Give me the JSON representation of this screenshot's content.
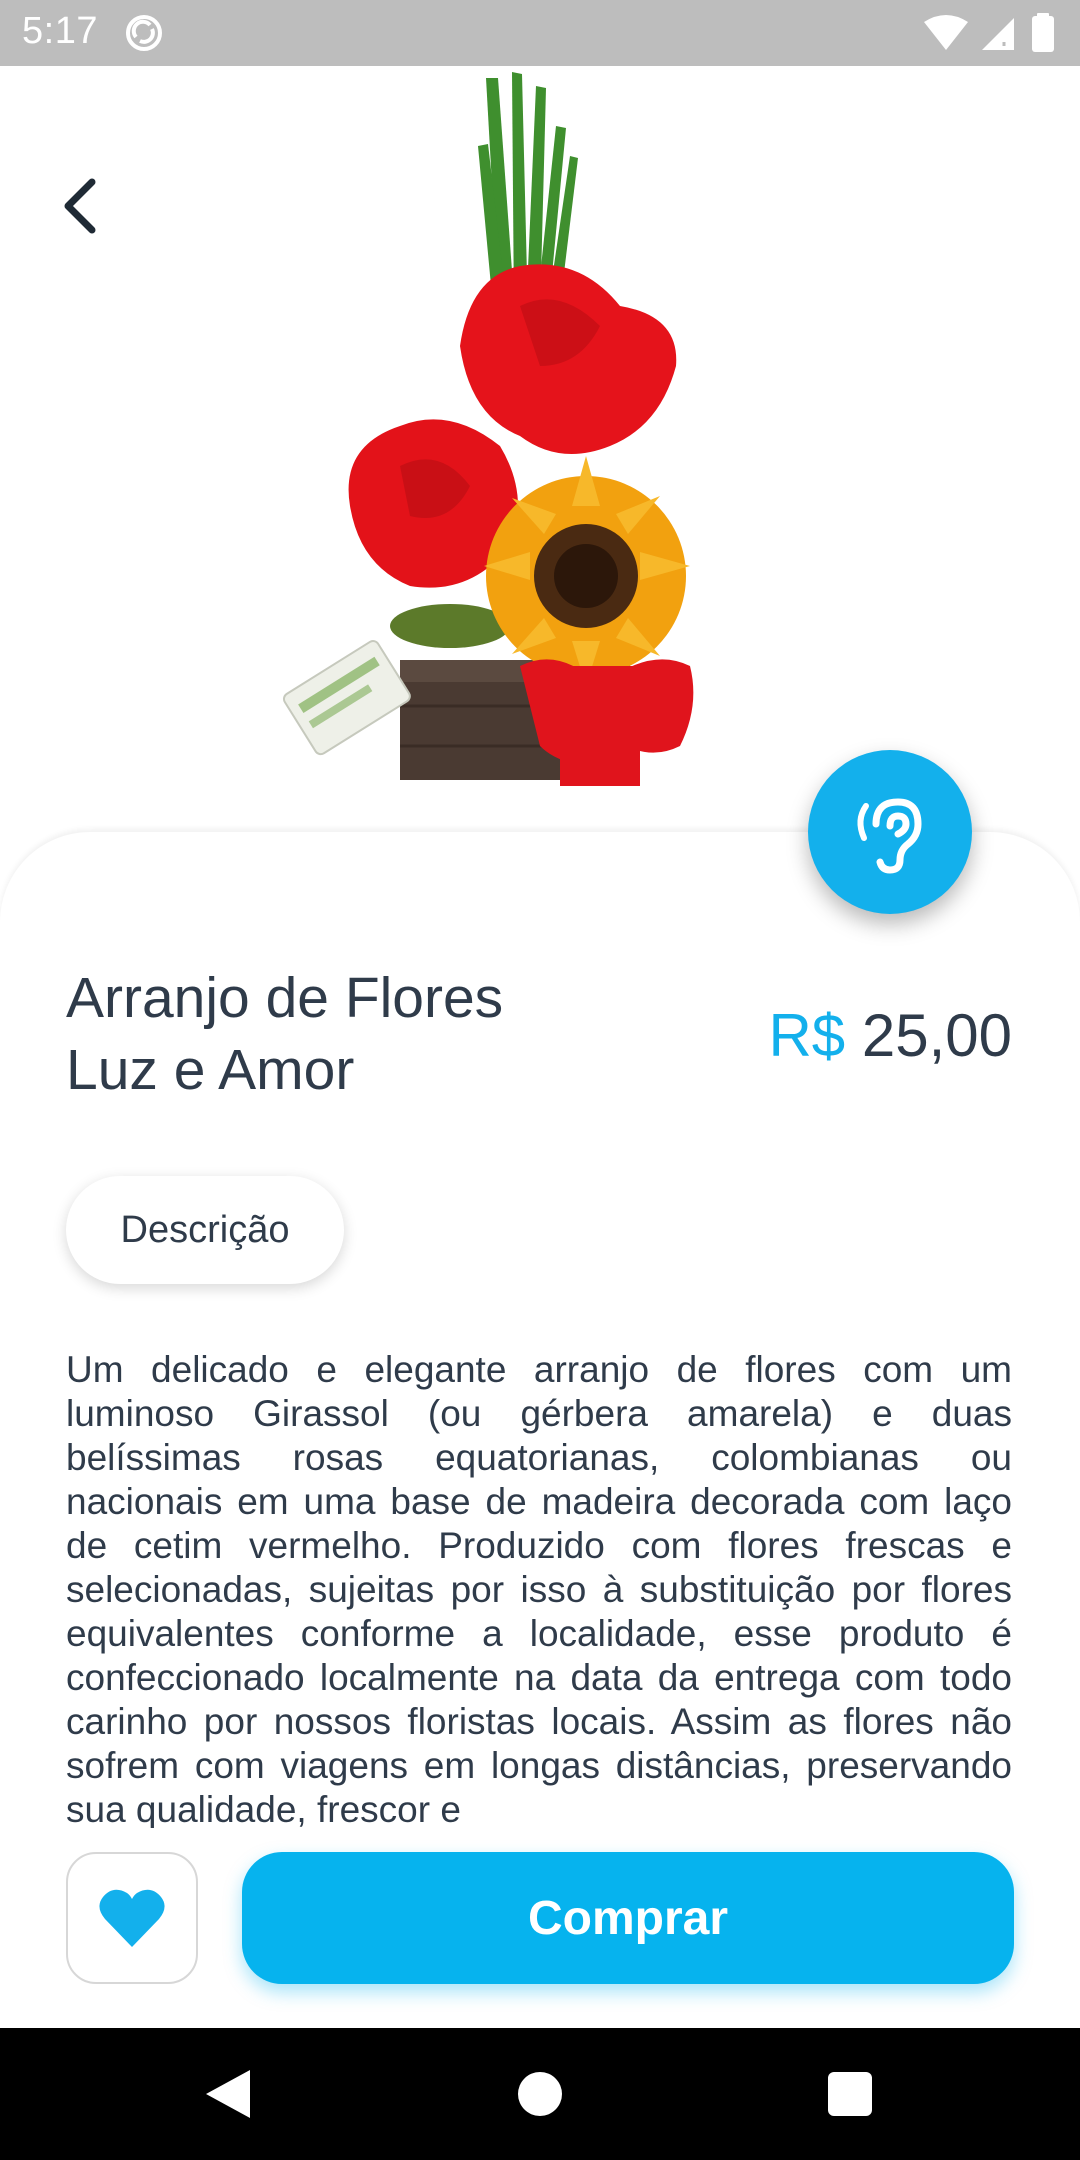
{
  "status_bar": {
    "time": "5:17",
    "icons": [
      "sync-icon",
      "wifi-icon",
      "signal-icon",
      "battery-icon"
    ]
  },
  "hero": {
    "image_subject": "flower-arrangement",
    "back_icon": "chevron-left-icon"
  },
  "listen_button": {
    "icon": "hearing-ear-icon"
  },
  "product": {
    "title_line1": "Arranjo de Flores",
    "title_line2": "Luz e Amor",
    "price_currency": "R$",
    "price_value": "25,00"
  },
  "tabs": {
    "description_label": "Descrição"
  },
  "description": "Um delicado e elegante arranjo de flores com um luminoso Girassol (ou gérbera amarela) e duas belíssimas rosas equatorianas, colombianas ou nacionais  em uma base de madeira decorada com laço de cetim vermelho. Produzido com flores frescas e selecionadas, sujeitas por isso à substituição por flores equivalentes conforme a localidade, esse produto é confeccionado localmente na data da entrega com todo carinho por nossos floristas locais. Assim as flores não sofrem com viagens em longas distâncias, preservando sua qualidade, frescor e",
  "actions": {
    "favorite_icon": "heart-icon",
    "buy_label": "Comprar"
  },
  "colors": {
    "accent": "#13b0ec",
    "button": "#06b3ee",
    "text": "#2f3b4a",
    "status_bar": "#bdbdbd"
  },
  "nav_bar": [
    "back-triangle-icon",
    "home-circle-icon",
    "recents-square-icon"
  ]
}
